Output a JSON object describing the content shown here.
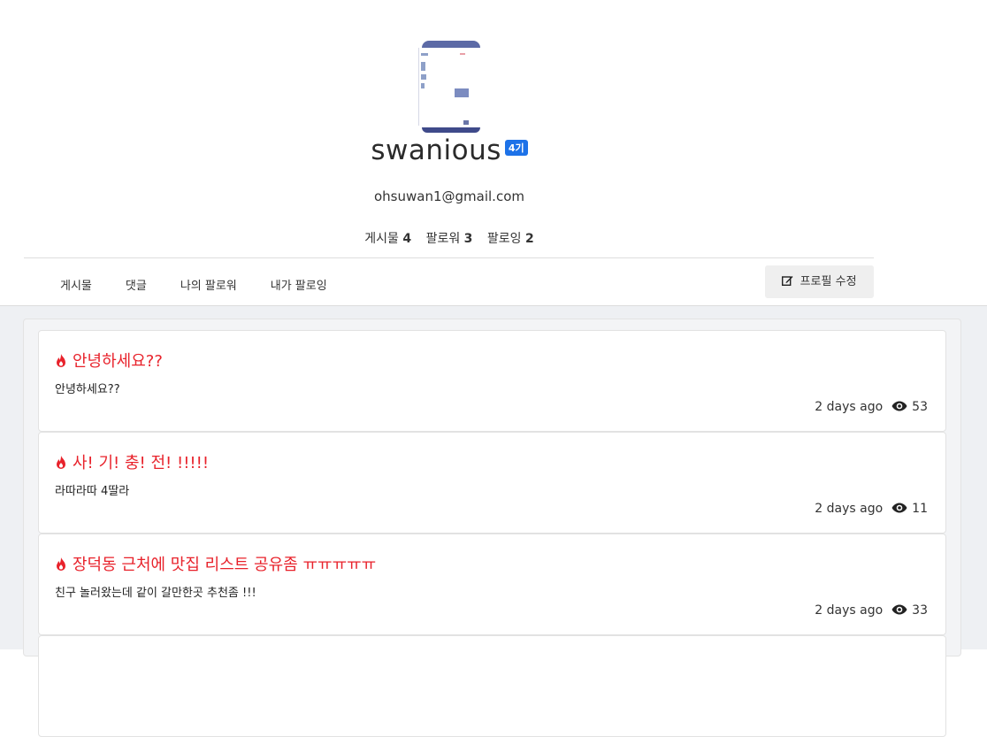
{
  "profile": {
    "name": "swanious",
    "generation_badge": "4기",
    "email": "ohsuwan1@gmail.com",
    "stats": {
      "posts_label": "게시물",
      "posts_count": "4",
      "followers_label": "팔로워",
      "followers_count": "3",
      "following_label": "팔로잉",
      "following_count": "2"
    }
  },
  "tabs": [
    {
      "label": "게시물"
    },
    {
      "label": "댓글"
    },
    {
      "label": "나의 팔로워"
    },
    {
      "label": "내가 팔로잉"
    }
  ],
  "edit_profile_label": "프로필 수정",
  "icons": {
    "edit": "edit-icon",
    "fire": "fire-icon",
    "eye": "eye-icon"
  },
  "colors": {
    "post_title": "#e8222b",
    "badge": "#1d72e8",
    "feed_background": "#eef0f3"
  },
  "posts": [
    {
      "title": "안녕하세요??",
      "body": "안녕하세요??",
      "time": "2 days ago",
      "views": "53"
    },
    {
      "title": "사! 기! 충! 전! !!!!!",
      "body": "라따라따 4딸라",
      "time": "2 days ago",
      "views": "11"
    },
    {
      "title": "장덕동 근처에 맛집 리스트 공유좀 ㅠㅠㅠㅠㅠ",
      "body": "친구 놀러왔는데 같이 갈만한곳 추천좀 !!!",
      "time": "2 days ago",
      "views": "33"
    }
  ]
}
